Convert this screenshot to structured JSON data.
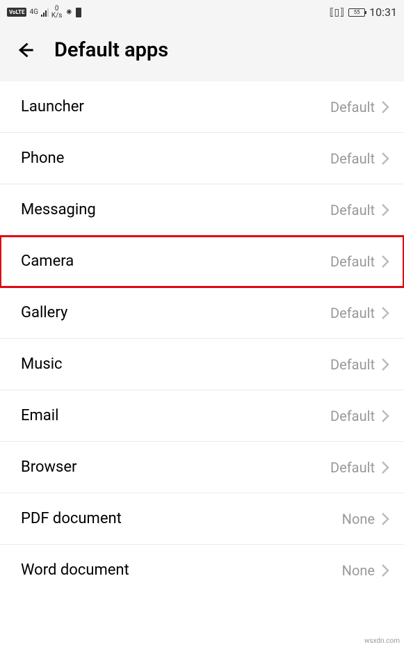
{
  "status_bar": {
    "volte": "VoLTE",
    "network": "4G",
    "speed_value": "0",
    "speed_unit": "K/s",
    "battery": "55",
    "time": "10:31"
  },
  "header": {
    "title": "Default apps"
  },
  "items": [
    {
      "label": "Launcher",
      "value": "Default",
      "highlighted": false
    },
    {
      "label": "Phone",
      "value": "Default",
      "highlighted": false
    },
    {
      "label": "Messaging",
      "value": "Default",
      "highlighted": false
    },
    {
      "label": "Camera",
      "value": "Default",
      "highlighted": true
    },
    {
      "label": "Gallery",
      "value": "Default",
      "highlighted": false
    },
    {
      "label": "Music",
      "value": "Default",
      "highlighted": false
    },
    {
      "label": "Email",
      "value": "Default",
      "highlighted": false
    },
    {
      "label": "Browser",
      "value": "Default",
      "highlighted": false
    },
    {
      "label": "PDF document",
      "value": "None",
      "highlighted": false
    },
    {
      "label": "Word document",
      "value": "None",
      "highlighted": false
    }
  ],
  "watermark": "wsxdn.com"
}
